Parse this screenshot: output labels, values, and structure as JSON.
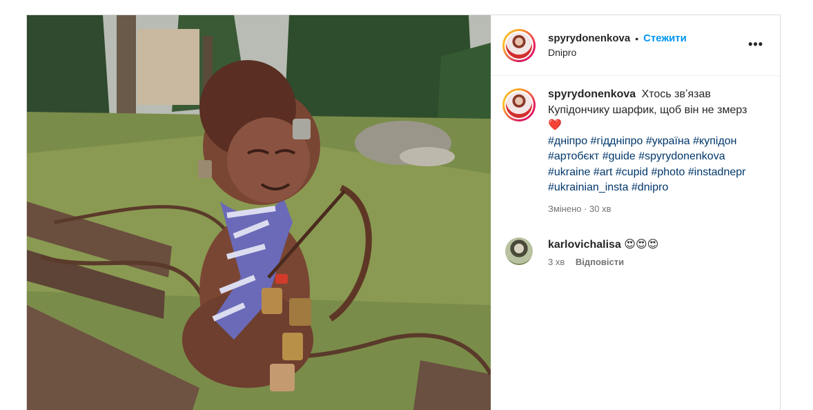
{
  "post": {
    "author": "spyrydonenkova",
    "separator": "•",
    "follow_label": "Стежити",
    "location": "Dnipro",
    "more_label": "•••",
    "caption_text": "Хтось звʼязав Купідончику шарфик, щоб він не змерз❤️",
    "hashtags": [
      "#дніпро",
      "#гіддніпро",
      "#україна",
      "#купідон",
      "#артобєкт",
      "#guide",
      "#spyrydonenkova",
      "#ukraine",
      "#art",
      "#cupid",
      "#photo",
      "#instadnepr",
      "#ukrainian_insta",
      "#dnipro"
    ],
    "caption_meta": "Змінено · 30 хв",
    "photo_alt": "Бронзова скульптура купідона з луком і замками, в в'язаному шарфику, на лавці в парку"
  },
  "comment": {
    "author": "karlovichalisa",
    "text": "😍😍😍",
    "time": "3 хв",
    "reply_label": "Відповісти"
  },
  "colors": {
    "accent": "#0095f6",
    "hashtag": "#00376b",
    "muted": "#737373",
    "border": "#dbdbdb"
  }
}
